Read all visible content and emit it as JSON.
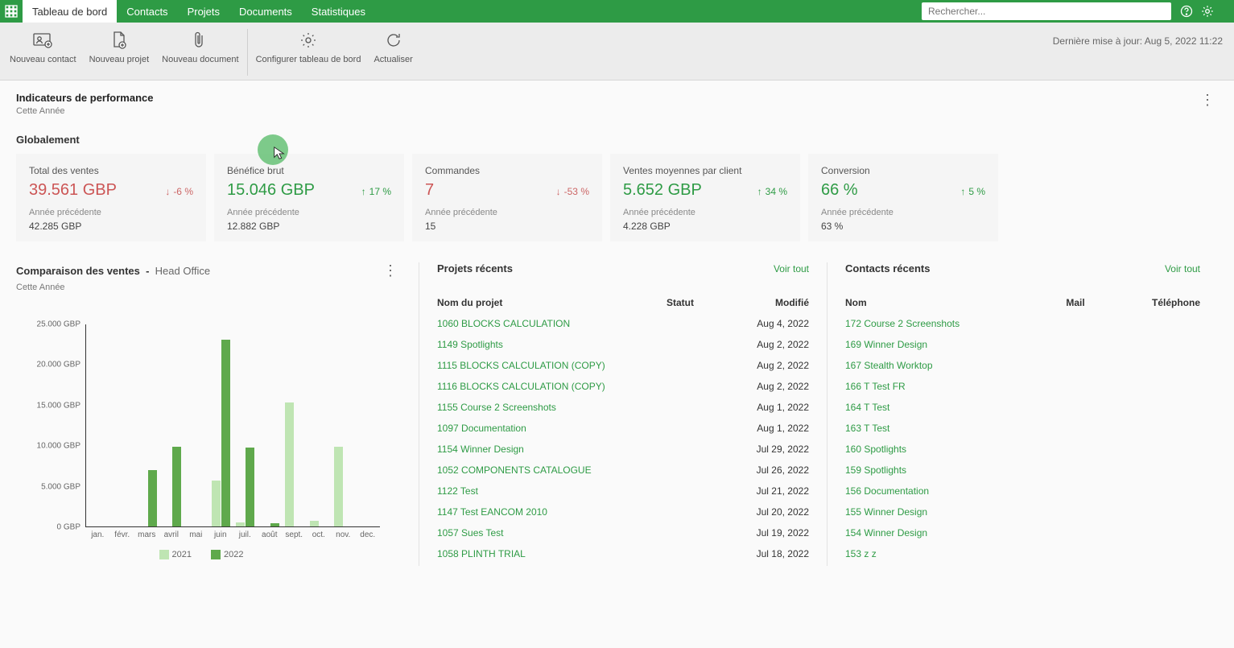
{
  "topnav": {
    "tabs": [
      "Tableau de bord",
      "Contacts",
      "Projets",
      "Documents",
      "Statistiques"
    ],
    "search_placeholder": "Rechercher...",
    "user_label": ""
  },
  "toolbar": {
    "items": [
      {
        "label": "Nouveau contact"
      },
      {
        "label": "Nouveau projet"
      },
      {
        "label": "Nouveau document"
      },
      {
        "label": "Configurer tableau de bord"
      },
      {
        "label": "Actualiser"
      }
    ],
    "last_update": "Dernière mise à jour: Aug 5, 2022 11:22"
  },
  "kpi": {
    "title": "Indicateurs de performance",
    "period": "Cette Année",
    "global": "Globalement",
    "prev_label": "Année précédente",
    "cards": [
      {
        "name": "Total des ventes",
        "value": "39.561 GBP",
        "delta": "-6 %",
        "dir": "down",
        "prev": "42.285 GBP",
        "color": "#c55"
      },
      {
        "name": "Bénéfice brut",
        "value": "15.046 GBP",
        "delta": "17 %",
        "dir": "up",
        "prev": "12.882 GBP",
        "color": "#2e9b45"
      },
      {
        "name": "Commandes",
        "value": "7",
        "delta": "-53 %",
        "dir": "down",
        "prev": "15",
        "color": "#c55"
      },
      {
        "name": "Ventes moyennes par client",
        "value": "5.652 GBP",
        "delta": "34 %",
        "dir": "up",
        "prev": "4.228 GBP",
        "color": "#2e9b45"
      },
      {
        "name": "Conversion",
        "value": "66 %",
        "delta": "5 %",
        "dir": "up",
        "prev": "63 %",
        "color": "#2e9b45"
      }
    ]
  },
  "sales": {
    "title": "Comparaison des ventes",
    "scope": "Head Office",
    "period": "Cette Année"
  },
  "chart_data": {
    "type": "bar",
    "title": "Comparaison des ventes - Head Office",
    "ylabel": "GBP",
    "ylim": [
      0,
      25000
    ],
    "categories": [
      "jan.",
      "févr.",
      "mars",
      "avril",
      "mai",
      "juin",
      "juil.",
      "août",
      "sept.",
      "oct.",
      "nov.",
      "dec."
    ],
    "series": [
      {
        "name": "2021",
        "values": [
          0,
          0,
          0,
          0,
          0,
          5700,
          500,
          0,
          15300,
          700,
          9800,
          0
        ]
      },
      {
        "name": "2022",
        "values": [
          0,
          0,
          6900,
          9800,
          0,
          23000,
          9700,
          400,
          0,
          0,
          0,
          0
        ]
      }
    ],
    "legend": [
      "2021",
      "2022"
    ]
  },
  "projects": {
    "title": "Projets récents",
    "voir": "Voir tout",
    "cols": {
      "name": "Nom du projet",
      "status": "Statut",
      "modified": "Modifié"
    },
    "rows": [
      {
        "name": "1060 BLOCKS CALCULATION",
        "status": "",
        "modified": "Aug 4, 2022"
      },
      {
        "name": "1149 Spotlights",
        "status": "",
        "modified": "Aug 2, 2022"
      },
      {
        "name": "1115 BLOCKS CALCULATION (COPY)",
        "status": "",
        "modified": "Aug 2, 2022"
      },
      {
        "name": "1116 BLOCKS CALCULATION (COPY)",
        "status": "",
        "modified": "Aug 2, 2022"
      },
      {
        "name": "1155 Course 2 Screenshots",
        "status": "",
        "modified": "Aug 1, 2022"
      },
      {
        "name": "1097 Documentation",
        "status": "",
        "modified": "Aug 1, 2022"
      },
      {
        "name": "1154 Winner Design",
        "status": "",
        "modified": "Jul 29, 2022"
      },
      {
        "name": "1052 COMPONENTS CATALOGUE",
        "status": "",
        "modified": "Jul 26, 2022"
      },
      {
        "name": "1122 Test",
        "status": "",
        "modified": "Jul 21, 2022"
      },
      {
        "name": "1147 Test EANCOM 2010",
        "status": "",
        "modified": "Jul 20, 2022"
      },
      {
        "name": "1057 Sues Test",
        "status": "",
        "modified": "Jul 19, 2022"
      },
      {
        "name": "1058 PLINTH TRIAL",
        "status": "",
        "modified": "Jul 18, 2022"
      }
    ]
  },
  "contacts": {
    "title": "Contacts récents",
    "voir": "Voir tout",
    "cols": {
      "name": "Nom",
      "mail": "Mail",
      "phone": "Téléphone"
    },
    "rows": [
      {
        "name": "172 Course 2 Screenshots"
      },
      {
        "name": "169 Winner Design"
      },
      {
        "name": "167 Stealth Worktop"
      },
      {
        "name": "166 T Test FR"
      },
      {
        "name": "164 T Test"
      },
      {
        "name": "163 T Test"
      },
      {
        "name": "160 Spotlights"
      },
      {
        "name": "159 Spotlights"
      },
      {
        "name": "156 Documentation"
      },
      {
        "name": "155 Winner Design"
      },
      {
        "name": "154 Winner Design"
      },
      {
        "name": "153 z z"
      }
    ]
  }
}
